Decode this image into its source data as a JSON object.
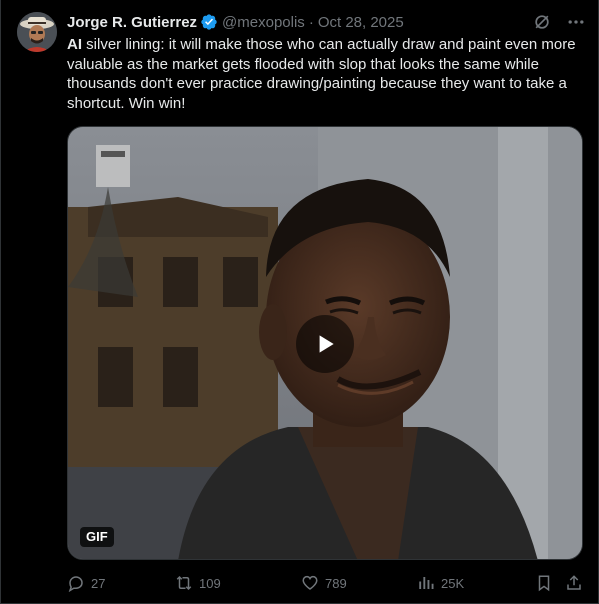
{
  "post": {
    "author_name": "Jorge R. Gutierrez",
    "handle": "@mexopolis",
    "separator": "·",
    "date": "Oct 28, 2025",
    "text_bold": "AI",
    "text_body": " silver lining: it will make those who can actually draw and paint even more valuable as the market gets flooded with slop that looks the same while thousands don't ever practice drawing/painting because they want to take a shortcut. Win win!",
    "media": {
      "badge": "GIF"
    }
  },
  "metrics": {
    "replies": "27",
    "reposts": "109",
    "likes": "789",
    "views": "25K"
  },
  "colors": {
    "background": "#000000",
    "text_primary": "#e7e9ea",
    "text_secondary": "#71767b",
    "verified_blue": "#1d9bf0"
  },
  "icons": [
    "verified-badge-icon",
    "grok-icon",
    "more-icon",
    "play-icon",
    "reply-icon",
    "repost-icon",
    "like-icon",
    "views-icon",
    "bookmark-icon",
    "share-icon"
  ]
}
